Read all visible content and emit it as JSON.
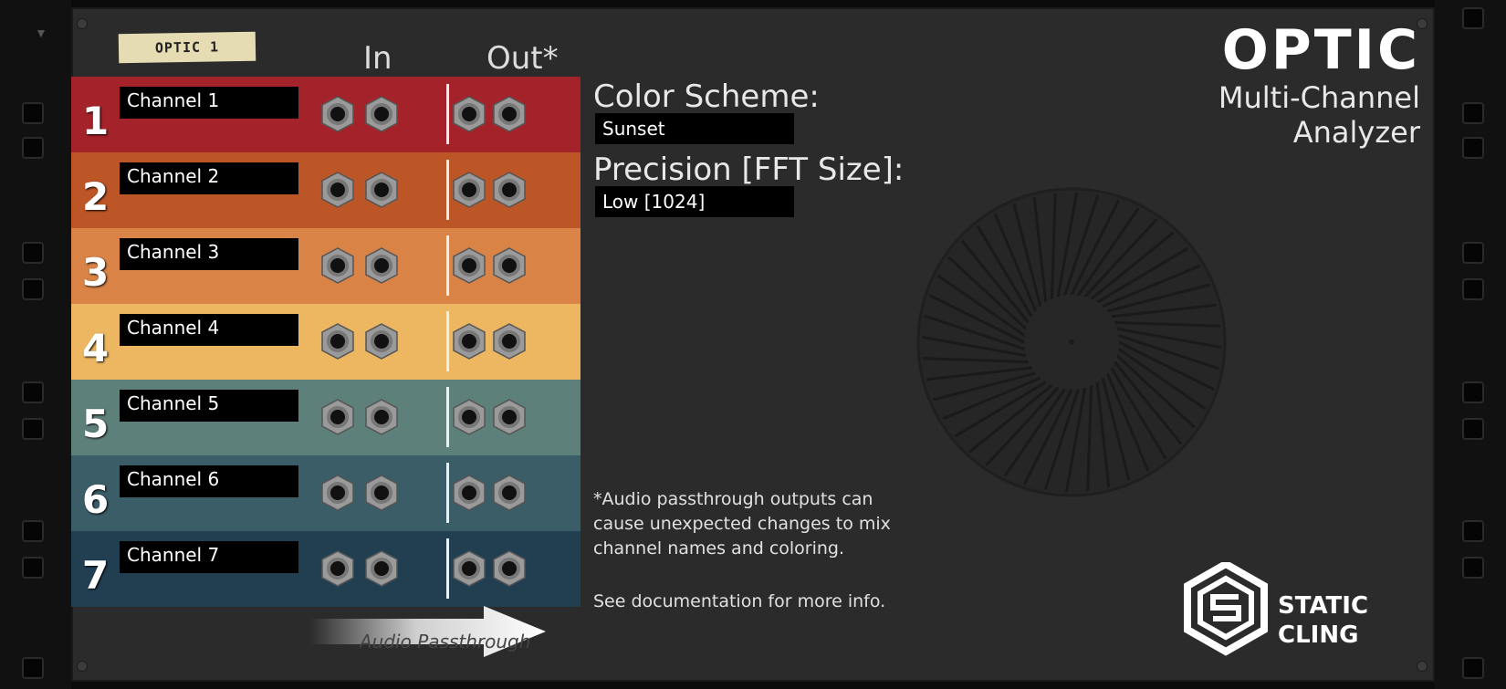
{
  "device": {
    "tape_label": "OPTIC 1",
    "col_in": "In",
    "col_out": "Out*",
    "logo": "OPTIC",
    "subtitle_line1": "Multi-Channel",
    "subtitle_line2": "Analyzer"
  },
  "channels": [
    {
      "num": "1",
      "name": "Channel 1",
      "color": "#a42229"
    },
    {
      "num": "2",
      "name": "Channel 2",
      "color": "#bd5626"
    },
    {
      "num": "3",
      "name": "Channel 3",
      "color": "#d98346"
    },
    {
      "num": "4",
      "name": "Channel 4",
      "color": "#edb660"
    },
    {
      "num": "5",
      "name": "Channel 5",
      "color": "#5d807b"
    },
    {
      "num": "6",
      "name": "Channel 6",
      "color": "#3b5d68"
    },
    {
      "num": "7",
      "name": "Channel 7",
      "color": "#223f52"
    }
  ],
  "settings": {
    "color_scheme_label": "Color Scheme:",
    "color_scheme_value": "Sunset",
    "precision_label": "Precision [FFT Size]:",
    "precision_value": "Low [1024]"
  },
  "notes": {
    "passthrough_note": "*Audio passthrough outputs can cause unexpected changes to mix channel names and coloring.",
    "doc_note": "See documentation for more info."
  },
  "arrow": {
    "label": "Audio Passthrough"
  },
  "brand": {
    "line1": "STATIC",
    "line2": "CLING"
  }
}
